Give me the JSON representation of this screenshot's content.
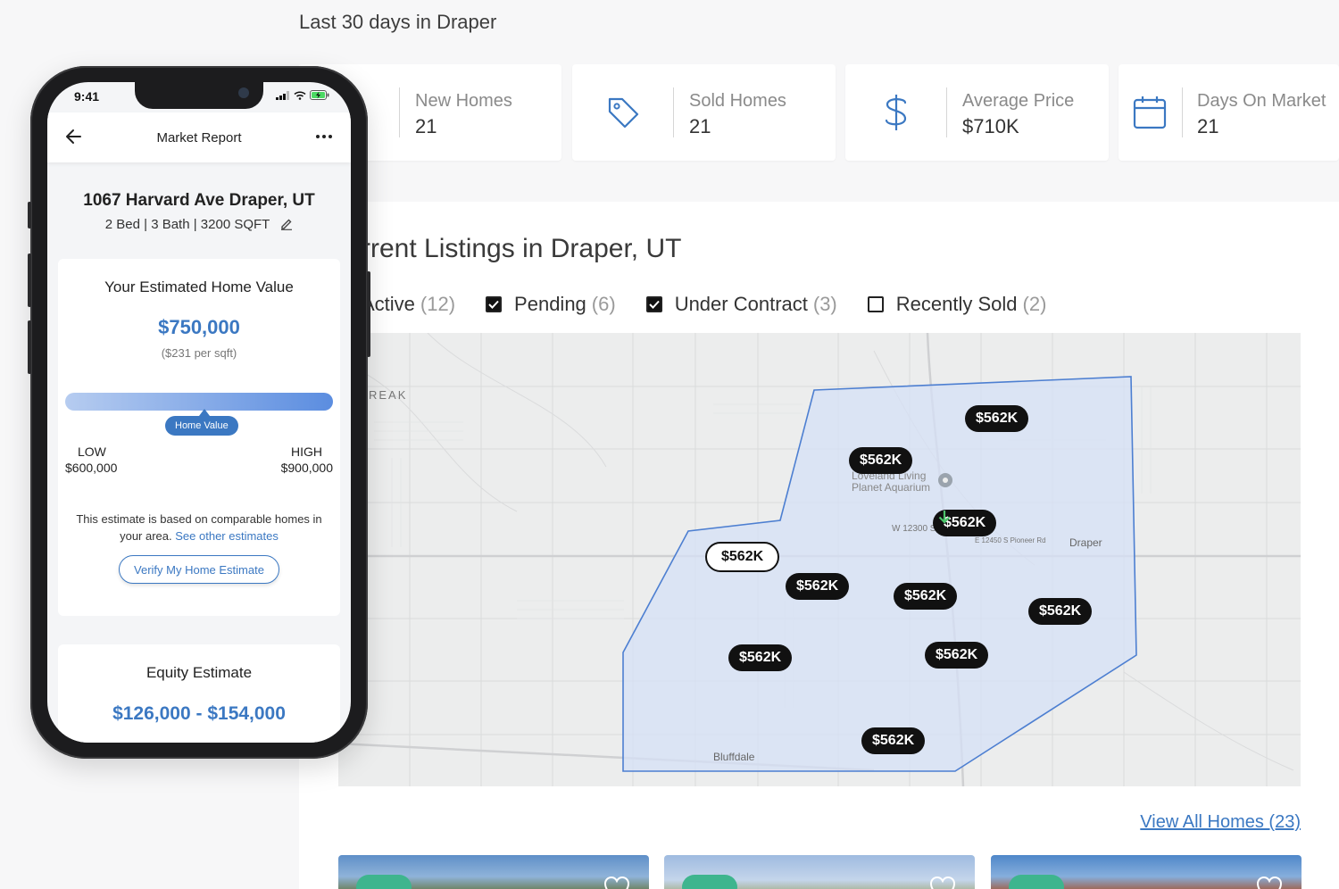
{
  "header": {
    "title": "Last 30 days in Draper"
  },
  "stats": [
    {
      "icon": "lightning-icon",
      "label": "New Homes",
      "value": "21"
    },
    {
      "icon": "price-tag-icon",
      "label": "Sold Homes",
      "value": "21"
    },
    {
      "icon": "dollar-icon",
      "label": "Average Price",
      "value": "$710K"
    },
    {
      "icon": "calendar-icon",
      "label": "Days On Market",
      "value": "21"
    }
  ],
  "listings": {
    "title": "rrent Listings in Draper, UT",
    "filters": [
      {
        "label": "Active",
        "count": "(12)",
        "checked": true
      },
      {
        "label": "Pending",
        "count": "(6)",
        "checked": true
      },
      {
        "label": "Under Contract",
        "count": "(3)",
        "checked": true
      },
      {
        "label": "Recently Sold",
        "count": "(2)",
        "checked": false
      }
    ],
    "view_all": "View All Homes (23)"
  },
  "map": {
    "labels": {
      "aquarium": "Loveland Living\nPlanet Aquarium",
      "draper": "Draper",
      "bluffdale": "Bluffdale",
      "reak": "REAK",
      "street1": "W 12300 S",
      "street2": "E 12450 S  Pioneer Rd"
    },
    "pins": [
      {
        "price": "$562K",
        "selected": false,
        "trend": ""
      },
      {
        "price": "$562K",
        "selected": false,
        "trend": ""
      },
      {
        "price": "$562K",
        "selected": false,
        "trend": "down"
      },
      {
        "price": "$562K",
        "selected": true,
        "trend": ""
      },
      {
        "price": "$562K",
        "selected": false,
        "trend": ""
      },
      {
        "price": "$562K",
        "selected": false,
        "trend": ""
      },
      {
        "price": "$562K",
        "selected": false,
        "trend": ""
      },
      {
        "price": "$562K",
        "selected": false,
        "trend": ""
      },
      {
        "price": "$562K",
        "selected": false,
        "trend": ""
      },
      {
        "price": "$562K",
        "selected": false,
        "trend": ""
      }
    ]
  },
  "phone": {
    "status_time": "9:41",
    "app_title": "Market Report",
    "address": "1067 Harvard Ave Draper, UT",
    "specs": "2 Bed | 3 Bath | 3200 SQFT",
    "value_card": {
      "title": "Your Estimated Home Value",
      "price": "$750,000",
      "per_sqft": "($231 per sqft)",
      "bar_label": "Home Value",
      "bar_position_pct": 50,
      "low_label": "LOW",
      "low_value": "$600,000",
      "high_label": "HIGH",
      "high_value": "$900,000",
      "note": "This estimate is based on comparable homes in your area.",
      "note_link": "See other estimates",
      "verify_button": "Verify My Home Estimate"
    },
    "equity": {
      "title": "Equity Estimate",
      "value": "$126,000 - $154,000"
    }
  },
  "colors": {
    "accent": "#3b78c2",
    "polygon_fill": "#d6e0f5",
    "polygon_stroke": "#4d7fd1",
    "badge_green": "#3eb58e"
  }
}
